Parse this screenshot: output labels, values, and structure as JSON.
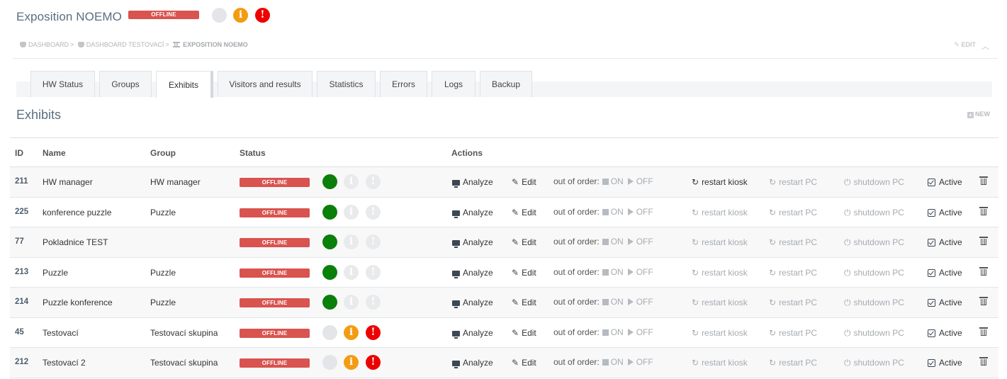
{
  "header": {
    "title": "Exposition NOEMO",
    "status": "OFFLINE",
    "icons": [
      "grey-dot-icon",
      "info-icon",
      "alert-icon"
    ]
  },
  "breadcrumb": {
    "items": [
      "DASHBOARD",
      "DASHBOARD TESTOVACÍ",
      "EXPOSITION NOEMO"
    ],
    "separator": ">"
  },
  "top_actions": {
    "edit_label": "EDIT",
    "collapse_icon": "chevron-up-icon"
  },
  "tabs": [
    {
      "label": "HW Status",
      "active": false
    },
    {
      "label": "Groups",
      "active": false
    },
    {
      "label": "Exhibits",
      "active": true
    },
    {
      "label": "Visitors and results",
      "active": false
    },
    {
      "label": "Statistics",
      "active": false
    },
    {
      "label": "Errors",
      "active": false
    },
    {
      "label": "Logs",
      "active": false
    },
    {
      "label": "Backup",
      "active": false
    }
  ],
  "section": {
    "title": "Exhibits",
    "new_label": "NEW"
  },
  "table": {
    "columns": [
      "ID",
      "Name",
      "Group",
      "Status",
      "Actions"
    ],
    "action_labels": {
      "analyze": "Analyze",
      "edit": "Edit",
      "out_of_order": "out of order:",
      "on": "ON",
      "off": "OFF",
      "restart_kiosk": "restart kiosk",
      "restart_pc": "restart PC",
      "shutdown_pc": "shutdown PC",
      "active": "Active"
    },
    "colors": {
      "offline": "#d9534f",
      "online": "#0a7f0a",
      "info": "#f39c12",
      "alert": "#ee0000"
    },
    "rows": [
      {
        "id": "211",
        "name": "HW manager",
        "group": "HW manager",
        "status": "OFFLINE",
        "indicator": "green",
        "alerts": false,
        "kiosk_enabled": true
      },
      {
        "id": "225",
        "name": "konference puzzle",
        "group": "Puzzle",
        "status": "OFFLINE",
        "indicator": "green",
        "alerts": false,
        "kiosk_enabled": false
      },
      {
        "id": "77",
        "name": "Pokladnice TEST",
        "group": "",
        "status": "OFFLINE",
        "indicator": "green",
        "alerts": false,
        "kiosk_enabled": false
      },
      {
        "id": "213",
        "name": "Puzzle",
        "group": "Puzzle",
        "status": "OFFLINE",
        "indicator": "green",
        "alerts": false,
        "kiosk_enabled": false
      },
      {
        "id": "214",
        "name": "Puzzle konference",
        "group": "Puzzle",
        "status": "OFFLINE",
        "indicator": "green",
        "alerts": false,
        "kiosk_enabled": false
      },
      {
        "id": "45",
        "name": "Testovací",
        "group": "Testovací skupina",
        "status": "OFFLINE",
        "indicator": "grey",
        "alerts": true,
        "kiosk_enabled": false
      },
      {
        "id": "212",
        "name": "Testovací 2",
        "group": "Testovací skupina",
        "status": "OFFLINE",
        "indicator": "grey",
        "alerts": true,
        "kiosk_enabled": false
      }
    ]
  }
}
